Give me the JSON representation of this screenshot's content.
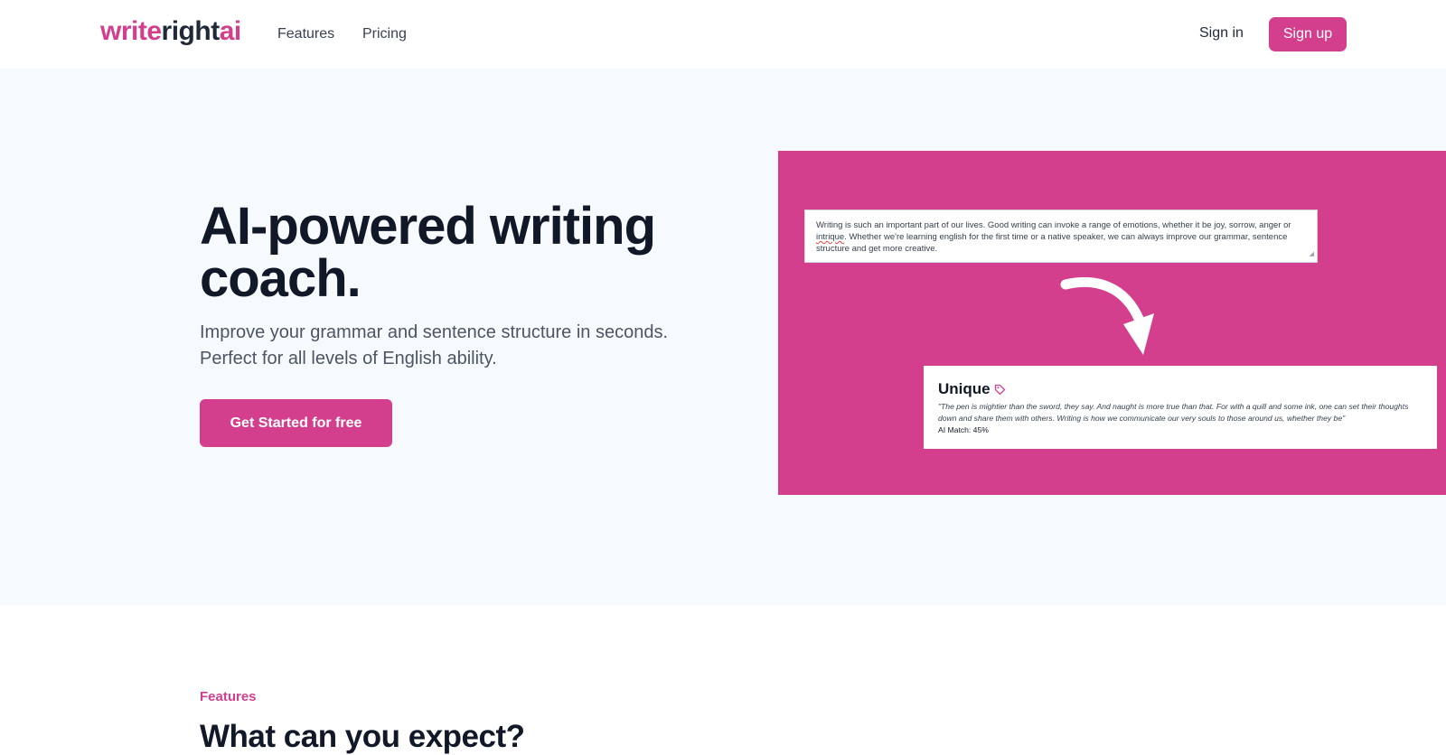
{
  "nav": {
    "logo_part1": "write",
    "logo_part2": "right",
    "logo_part3": "ai",
    "links": [
      "Features",
      "Pricing"
    ],
    "signin_label": "Sign in",
    "signup_label": "Sign up"
  },
  "hero": {
    "headline": "AI-powered writing coach.",
    "subtitle": "Improve your grammar and sentence structure in seconds. Perfect for all levels of English ability.",
    "cta_label": "Get Started for free"
  },
  "demo": {
    "input_text_before": "Writing is such an important part of our lives. Good writing can invoke a range of emotions, whether it be joy, sorrow, anger or ",
    "input_misspelled": "intrique",
    "input_text_after": ". Whether we're learning english for the first time or a native speaker, we can always improve our grammar, sentence structure and get more creative.",
    "result_title": "Unique",
    "result_quote": "\"The pen is mightier than the sword, they say. And naught is more true than that. For with a quill and some ink, one can set their thoughts down and share them with others. Writing is how we communicate our very souls to those around us, whether they be\"",
    "result_match": "AI Match: 45%"
  },
  "features": {
    "label": "Features",
    "title": "What can you expect?"
  },
  "colors": {
    "brand": "#d33f8d",
    "hero_bg": "#f7fafc"
  },
  "icons": {
    "arrow": "curved-arrow-icon",
    "unique": "tag-icon"
  }
}
